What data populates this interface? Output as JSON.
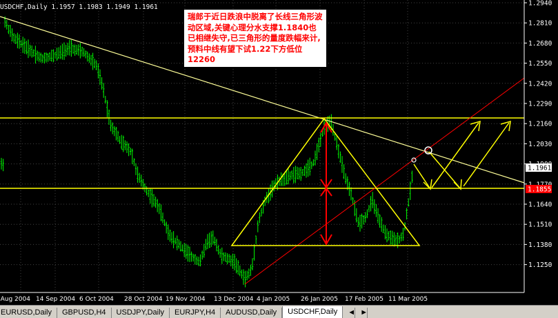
{
  "window": {
    "chart_header": "USDCHF,Daily  1.1957 1.1983 1.1949 1.1961"
  },
  "price_axis": {
    "labels": [
      "1.2940",
      "1.2810",
      "1.2680",
      "1.2550",
      "1.2420",
      "1.2290",
      "1.2160",
      "1.2030",
      "1.1900",
      "1.1770",
      "1.1640",
      "1.1510",
      "1.1380",
      "1.1250"
    ],
    "current_price": "1.1961",
    "current_price_bg": "#ffffff",
    "line_price": "1.1855",
    "line_price_bg": "#ff0000"
  },
  "time_axis": {
    "labels": [
      "8 Aug 2004",
      "14 Sep 2004",
      "6 Oct 2004",
      "28 Oct 2004",
      "19 Nov 2004",
      "13 Dec 2004",
      "4 Jan 2005",
      "26 Jan 2005",
      "17 Feb 2005",
      "11 Mar 2005"
    ]
  },
  "annotation": {
    "text": "瑞郎于近日跌浪中脱离了长线三角形波动区域,关键心理分水支撑1.1840也已相继失守,已三角形的量度跌幅来计,预料中线有望下试1.22下方低位12260"
  },
  "tabs": [
    {
      "label": "EURUSD,Daily",
      "active": false
    },
    {
      "label": "GBPUSD,H4",
      "active": false
    },
    {
      "label": "USDJPY,Daily",
      "active": false
    },
    {
      "label": "EURJPY,H4",
      "active": false
    },
    {
      "label": "AUDUSD,Daily",
      "active": false
    },
    {
      "label": "USDCHF,Daily",
      "active": true
    }
  ],
  "tab_nav": {
    "prev_icon": "◄",
    "next_icon": "►"
  },
  "colors": {
    "background": "#000000",
    "bars": "#00ff00",
    "trendline": "#ffff80",
    "horizontal_lines": "#ffff00",
    "triangle": "#ffff00",
    "channel": "#ff0000",
    "arrows": "#ff0000",
    "text": "#ffffff"
  }
}
